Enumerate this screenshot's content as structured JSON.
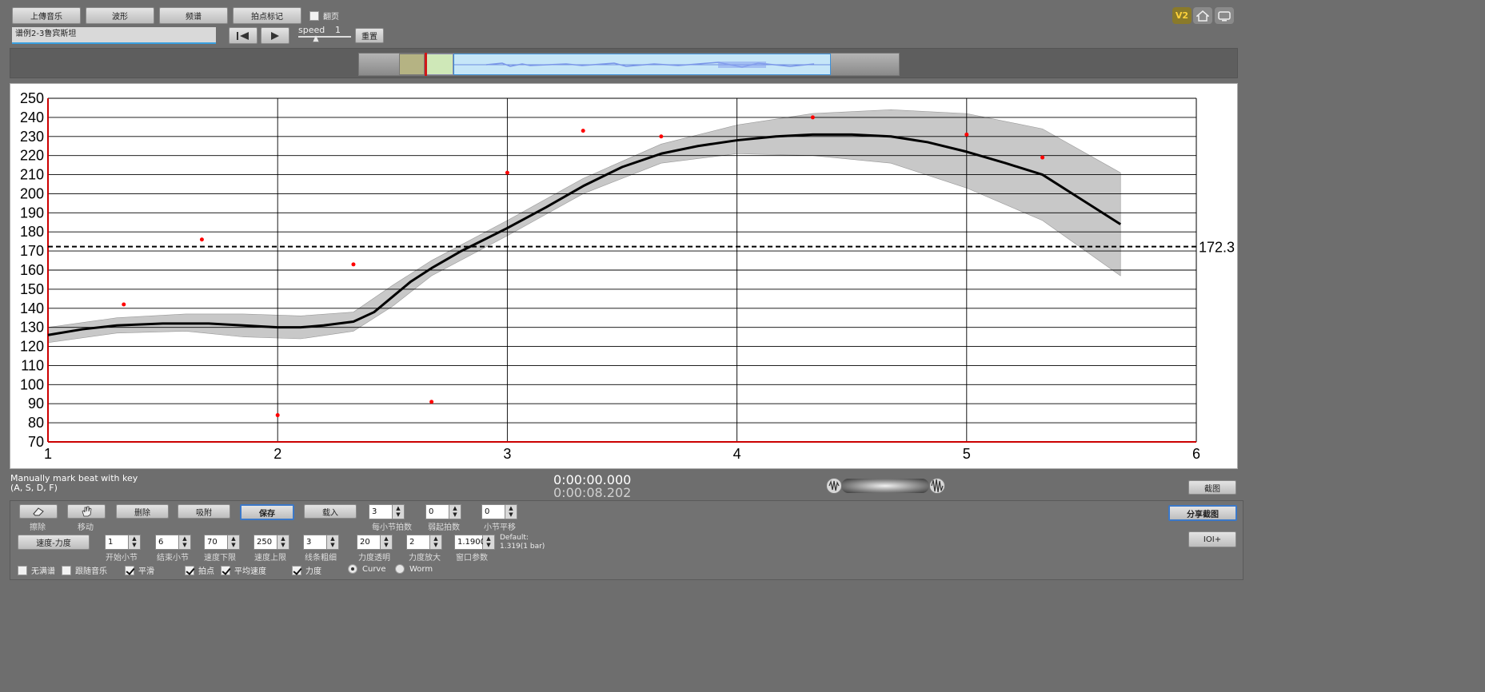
{
  "toolbar": {
    "upload_label": "上傳音乐",
    "waveform_label": "波形",
    "spectrum_label": "频谱",
    "beat_mark_label": "拍点标记",
    "flip_label": "翻页",
    "file_name": "谱例2-3鲁宾斯坦",
    "speed_label": "speed",
    "speed_value": "1",
    "reset_label": "重置"
  },
  "top_right_icons": [
    "v2-logo-icon",
    "home-icon",
    "screen-icon"
  ],
  "status": {
    "hint_line1": "Manually mark beat with key",
    "hint_line2": "(A, S, D, F)",
    "time_current": "0:00:00.000",
    "time_total": "0:00:08.202",
    "screenshot_label": "截图"
  },
  "bottom": {
    "erase_label": "擦除",
    "move_label": "移动",
    "delete_label": "删除",
    "snap_label": "吸附",
    "save_label": "保存",
    "load_label": "载入",
    "beats_per_bar": "3",
    "beats_per_bar_label": "每小节拍数",
    "pickup_beats": "0",
    "pickup_beats_label": "弱起拍数",
    "bar_offset": "0",
    "bar_offset_label": "小节平移",
    "tempo_dyn_label": "速度-力度",
    "start_bar": "1",
    "start_bar_label": "开始小节",
    "end_bar": "6",
    "end_bar_label": "结束小节",
    "tempo_min": "70",
    "tempo_min_label": "速度下限",
    "tempo_max": "250",
    "tempo_max_label": "速度上限",
    "line_width": "3",
    "line_width_label": "线条粗细",
    "dyn_transparency": "20",
    "dyn_transparency_label": "力度透明",
    "dyn_zoom": "2",
    "dyn_zoom_label": "力度放大",
    "window_param": "1.1900",
    "window_param_label": "窗口参数",
    "default_line1": "Default:",
    "default_line2": "1.319(1 bar)",
    "share_label": "分享截图",
    "ioi_label": "IOI+",
    "cb_no_beat": "无满谱",
    "cb_follow_music": "跟随音乐",
    "cb_smooth": "平滑",
    "cb_beat_points": "拍点",
    "cb_avg_tempo": "平均速度",
    "cb_dynamics": "力度",
    "radio_curve": "Curve",
    "radio_worm": "Worm"
  },
  "chart_data": {
    "type": "line",
    "xlim": [
      1,
      6
    ],
    "ylim": [
      70,
      250
    ],
    "x_ticks": [
      1,
      2,
      3,
      4,
      5,
      6
    ],
    "y_ticks": [
      70,
      80,
      90,
      100,
      110,
      120,
      130,
      140,
      150,
      160,
      170,
      180,
      190,
      200,
      210,
      220,
      230,
      240,
      250
    ],
    "average_tempo": 172.3,
    "average_label": "172.3",
    "beat_points": [
      {
        "x": 1.33,
        "y": 142
      },
      {
        "x": 1.67,
        "y": 176
      },
      {
        "x": 2.0,
        "y": 84
      },
      {
        "x": 2.33,
        "y": 163
      },
      {
        "x": 2.67,
        "y": 91
      },
      {
        "x": 3.0,
        "y": 211
      },
      {
        "x": 3.33,
        "y": 233
      },
      {
        "x": 3.67,
        "y": 230
      },
      {
        "x": 4.33,
        "y": 240
      },
      {
        "x": 5.0,
        "y": 231
      },
      {
        "x": 5.33,
        "y": 219
      }
    ],
    "smoothed_curve": [
      {
        "x": 1.0,
        "y": 126
      },
      {
        "x": 1.15,
        "y": 129
      },
      {
        "x": 1.3,
        "y": 131
      },
      {
        "x": 1.5,
        "y": 132
      },
      {
        "x": 1.7,
        "y": 132
      },
      {
        "x": 1.85,
        "y": 131
      },
      {
        "x": 2.0,
        "y": 130
      },
      {
        "x": 2.1,
        "y": 130
      },
      {
        "x": 2.2,
        "y": 131
      },
      {
        "x": 2.33,
        "y": 133
      },
      {
        "x": 2.42,
        "y": 138
      },
      {
        "x": 2.5,
        "y": 146
      },
      {
        "x": 2.58,
        "y": 154
      },
      {
        "x": 2.67,
        "y": 161
      },
      {
        "x": 2.8,
        "y": 170
      },
      {
        "x": 3.0,
        "y": 182
      },
      {
        "x": 3.17,
        "y": 193
      },
      {
        "x": 3.33,
        "y": 204
      },
      {
        "x": 3.5,
        "y": 214
      },
      {
        "x": 3.67,
        "y": 221
      },
      {
        "x": 3.83,
        "y": 225
      },
      {
        "x": 4.0,
        "y": 228
      },
      {
        "x": 4.17,
        "y": 230
      },
      {
        "x": 4.33,
        "y": 231
      },
      {
        "x": 4.5,
        "y": 231
      },
      {
        "x": 4.67,
        "y": 230
      },
      {
        "x": 4.83,
        "y": 227
      },
      {
        "x": 5.0,
        "y": 222
      },
      {
        "x": 5.17,
        "y": 216
      },
      {
        "x": 5.33,
        "y": 210
      },
      {
        "x": 5.5,
        "y": 197
      },
      {
        "x": 5.67,
        "y": 184
      }
    ],
    "dynamics_band_upper": [
      {
        "x": 1.0,
        "y": 130
      },
      {
        "x": 1.3,
        "y": 135
      },
      {
        "x": 1.6,
        "y": 137
      },
      {
        "x": 1.85,
        "y": 137
      },
      {
        "x": 2.1,
        "y": 136
      },
      {
        "x": 2.33,
        "y": 138
      },
      {
        "x": 2.5,
        "y": 152
      },
      {
        "x": 2.67,
        "y": 165
      },
      {
        "x": 3.0,
        "y": 186
      },
      {
        "x": 3.33,
        "y": 208
      },
      {
        "x": 3.67,
        "y": 226
      },
      {
        "x": 4.0,
        "y": 236
      },
      {
        "x": 4.33,
        "y": 242
      },
      {
        "x": 4.67,
        "y": 244
      },
      {
        "x": 5.0,
        "y": 242
      },
      {
        "x": 5.33,
        "y": 234
      },
      {
        "x": 5.67,
        "y": 211
      }
    ],
    "dynamics_band_lower": [
      {
        "x": 5.67,
        "y": 157
      },
      {
        "x": 5.33,
        "y": 186
      },
      {
        "x": 5.0,
        "y": 203
      },
      {
        "x": 4.67,
        "y": 216
      },
      {
        "x": 4.33,
        "y": 220
      },
      {
        "x": 4.0,
        "y": 221
      },
      {
        "x": 3.67,
        "y": 216
      },
      {
        "x": 3.33,
        "y": 200
      },
      {
        "x": 3.0,
        "y": 178
      },
      {
        "x": 2.67,
        "y": 157
      },
      {
        "x": 2.5,
        "y": 141
      },
      {
        "x": 2.33,
        "y": 128
      },
      {
        "x": 2.1,
        "y": 124
      },
      {
        "x": 1.85,
        "y": 125
      },
      {
        "x": 1.6,
        "y": 128
      },
      {
        "x": 1.3,
        "y": 127
      },
      {
        "x": 1.0,
        "y": 122
      }
    ],
    "colors": {
      "curve": "#000000",
      "band": "#c8c8c8",
      "beat_point": "#ff0000",
      "average_line": "#000000",
      "axis_lines": "#cc0000"
    }
  }
}
